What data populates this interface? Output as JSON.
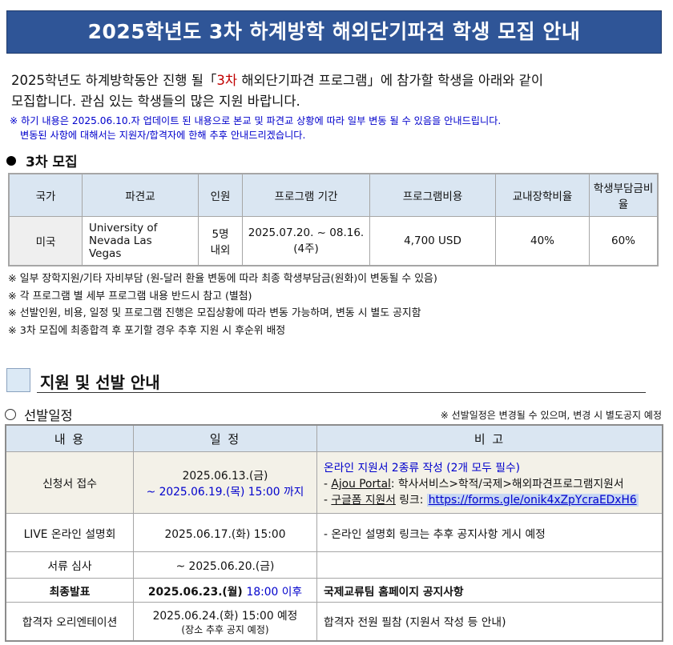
{
  "title": "2025학년도 3차 하계방학 해외단기파견 학생 모집 안내",
  "intro": {
    "pre": "2025학년도 하계방학동안 진행 될「",
    "highlight": "3차",
    "post": " 해외단기파견 프로그램」에 참가할 학생을 아래와 같이",
    "line2": "모집합니다. 관심 있는 학생들의 많은 지원 바랍니다."
  },
  "notice": {
    "line1": "※ 하기 내용은 2025.06.10.자 업데이트 된 내용으로 본교 및 파견교 상황에 따라 일부 변동 될 수 있음을 안내드립니다.",
    "line2": "변동된 사항에 대해서는 지원자/합격자에 한해 추후 안내드리겠습니다."
  },
  "section1": {
    "title": "3차 모집"
  },
  "recruit_table": {
    "headers": [
      "국가",
      "파견교",
      "인원",
      "프로그램 기간",
      "프로그램비용",
      "교내장학비율",
      "학생부담금비율"
    ],
    "row": {
      "country": "미국",
      "university_l1": "University of",
      "university_l2": "Nevada Las",
      "university_l3": "Vegas",
      "count_l1": "5명",
      "count_l2": "내외",
      "period_l1": "2025.07.20. ~ 08.16.",
      "period_l2": "(4주)",
      "cost": "4,700 USD",
      "scholarship": "40%",
      "student": "60%"
    }
  },
  "notes": [
    "※ 일부 장학지원/기타 자비부담 (원-달러 환율 변동에 따라 최종 학생부담금(원화)이 변동될 수 있음)",
    "※ 각 프로그램 별 세부 프로그램 내용 반드시 참고 (별첨)",
    "※ 선발인원, 비용, 일정 및 프로그램 진행은 모집상황에 따라 변동 가능하며, 변동 시 별도 공지함",
    "※ 3차 모집에 최종합격 후 포기할 경우 추후 지원 시 후순위 배정"
  ],
  "section2": {
    "title": "지원 및 선발 안내"
  },
  "schedule": {
    "title": "선발일정",
    "note": "※ 선발일정은 변경될 수 있으며, 변경 시 별도공지 예정",
    "headers": [
      "내 용",
      "일 정",
      "비 고"
    ],
    "rows": {
      "apply": {
        "content": "신청서 접수",
        "date_l1": "2025.06.13.(금)",
        "date_l2": "~ 2025.06.19.(목) 15:00 까지",
        "note_l1": "온라인 지원서 2종류 작성 (2개 모두 필수)",
        "note_l2_prefix": "- ",
        "note_l2_link": "Ajou Portal",
        "note_l2_rest": ": 학사서비스>학적/국제>해외파견프로그램지원서",
        "note_l3_prefix": "- ",
        "note_l3_link": "구글폼 지원서",
        "note_l3_mid": " 링크: ",
        "note_l3_url": "https://forms.gle/onik4xZpYcraEDxH6"
      },
      "live": {
        "content": "LIVE 온라인 설명회",
        "date": "2025.06.17.(화) 15:00",
        "note": "- 온라인 설명회 링크는 추후 공지사항 게시 예정"
      },
      "review": {
        "content": "서류 심사",
        "date": "~ 2025.06.20.(금)",
        "note": ""
      },
      "final": {
        "content": "최종발표",
        "date_pre": "2025.06.23.(월) ",
        "date_time": "18:00 이후",
        "note": "국제교류팀 홈페이지 공지사항"
      },
      "orientation": {
        "content": "합격자 오리엔테이션",
        "date_l1": "2025.06.24.(화) 15:00 예정",
        "date_l2": "(장소 추후 공지 예정)",
        "note": "합격자 전원 필참 (지원서 작성 등 안내)"
      }
    }
  }
}
